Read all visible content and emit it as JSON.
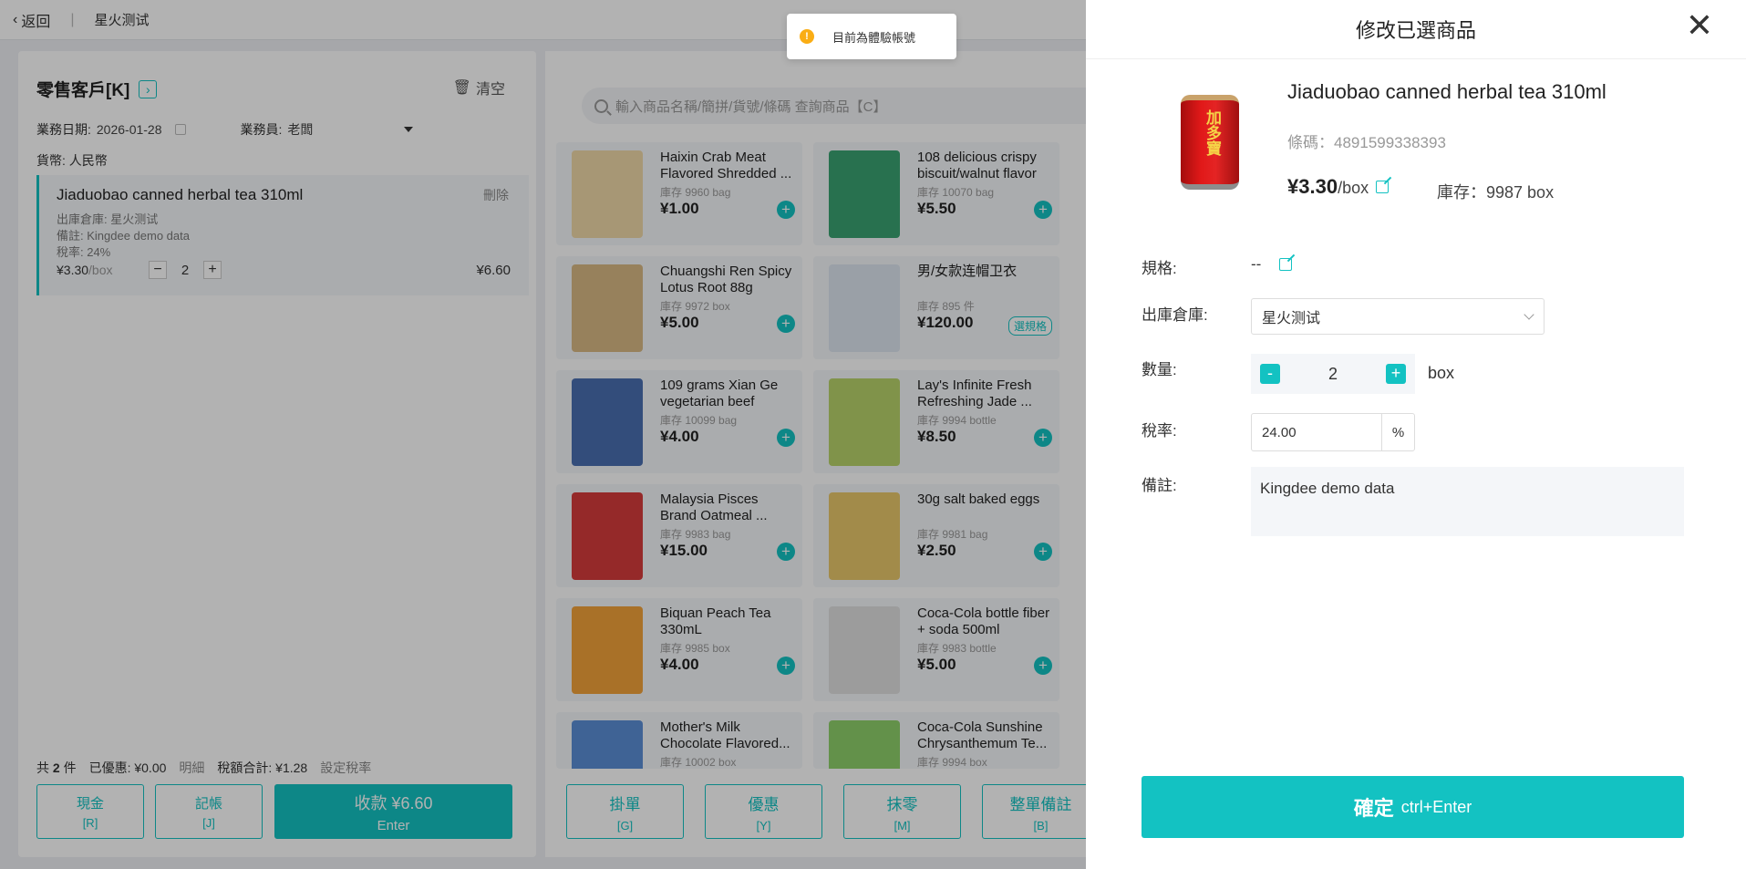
{
  "topbar": {
    "back_label": "返回",
    "store_name": "星火测试"
  },
  "cart": {
    "customer": "零售客戶[K]",
    "clear_label": "清空",
    "date_label": "業務日期:",
    "date_value": "2026-01-28",
    "salesperson_label": "業務員:",
    "salesperson_value": "老闆",
    "currency_label": "貨幣:",
    "currency_value": "人民幣",
    "item": {
      "name": "Jiaduobao canned herbal tea 310ml",
      "delete_label": "刪除",
      "warehouse": "出庫倉庫: 星火测试",
      "remark": "備註: Kingdee demo data",
      "tax_rate": "稅率: 24%",
      "price": "¥3.30",
      "unit": "/box",
      "qty": "2",
      "total": "¥6.60"
    },
    "summary": {
      "count_prefix": "共",
      "count": "2",
      "count_suffix": "件",
      "discount": "已優惠: ¥0.00",
      "detail": "明細",
      "tax_total": "稅額合計: ¥1.28",
      "set_tax": "設定稅率"
    },
    "buttons": {
      "cash": "現金",
      "cash_sc": "[R]",
      "credit": "記帳",
      "credit_sc": "[J]",
      "pay": "收款 ¥6.60",
      "pay_sc": "Enter"
    }
  },
  "products": {
    "search_placeholder": "輸入商品名稱/簡拼/貨號/條碼 查詢商品【C】",
    "items": [
      {
        "name": "Haixin Crab Meat Flavored Shredded ...",
        "stock": "庫存 9960 bag",
        "price": "¥1.00",
        "color": "#f0d9a8"
      },
      {
        "name": "108 delicious crispy biscuit/walnut flavor",
        "stock": "庫存 10070 bag",
        "price": "¥5.50",
        "color": "#3aa272"
      },
      {
        "name": "Chuangshi Ren Spicy Lotus Root 88g",
        "stock": "庫存 9972 box",
        "price": "¥5.00",
        "color": "#d8b985"
      },
      {
        "name": "男/女款连帽卫衣",
        "stock": "庫存 895 件",
        "price": "¥120.00",
        "color": "#dde6f0",
        "spec": "選規格"
      },
      {
        "name": "109 grams Xian Ge vegetarian beef",
        "stock": "庫存 10099 bag",
        "price": "¥4.00",
        "color": "#4a6fb0"
      },
      {
        "name": "Lay's Infinite Fresh Refreshing Jade ...",
        "stock": "庫存 9994 bottle",
        "price": "¥8.50",
        "color": "#b8d36a"
      },
      {
        "name": "Malaysia Pisces Brand Oatmeal ...",
        "stock": "庫存 9983 bag",
        "price": "¥15.00",
        "color": "#d63b3b"
      },
      {
        "name": "30g salt baked eggs",
        "stock": "庫存 9981 bag",
        "price": "¥2.50",
        "color": "#e9c86b"
      },
      {
        "name": "Biquan Peach Tea 330mL",
        "stock": "庫存 9985 box",
        "price": "¥4.00",
        "color": "#f2a23a"
      },
      {
        "name": "Coca-Cola bottle fiber + soda 500ml",
        "stock": "庫存 9983 bottle",
        "price": "¥5.00",
        "color": "#e0e0e0"
      },
      {
        "name": "Mother's Milk Chocolate Flavored...",
        "stock": "庫存 10002 box",
        "price": "",
        "color": "#5b8ed6"
      },
      {
        "name": "Coca-Cola Sunshine Chrysanthemum Te...",
        "stock": "庫存 9994 box",
        "price": "",
        "color": "#8fd06a"
      }
    ],
    "buttons": [
      {
        "label": "掛單",
        "sc": "[G]"
      },
      {
        "label": "優惠",
        "sc": "[Y]"
      },
      {
        "label": "抹零",
        "sc": "[M]"
      },
      {
        "label": "整單備註",
        "sc": "[B]"
      }
    ]
  },
  "toast": {
    "text": "目前為體驗帳號"
  },
  "dialog": {
    "title": "修改已選商品",
    "product_name": "Jiaduobao canned herbal tea 310ml",
    "barcode": "條碼：4891599338393",
    "price": "¥3.30",
    "unit": "/box",
    "stock": "庫存：9987 box",
    "image_text": "加多寶",
    "spec_label": "規格:",
    "spec_value": "--",
    "warehouse_label": "出庫倉庫:",
    "warehouse_value": "星火测试",
    "qty_label": "數量:",
    "qty_value": "2",
    "qty_minus": "-",
    "qty_plus": "+",
    "qty_unit": "box",
    "tax_label": "稅率:",
    "tax_value": "24.00",
    "tax_pct": "%",
    "remark_label": "備註:",
    "remark_value": "Kingdee demo data",
    "confirm": "確定",
    "confirm_sc": "ctrl+Enter",
    "close_icon": "close-icon"
  }
}
